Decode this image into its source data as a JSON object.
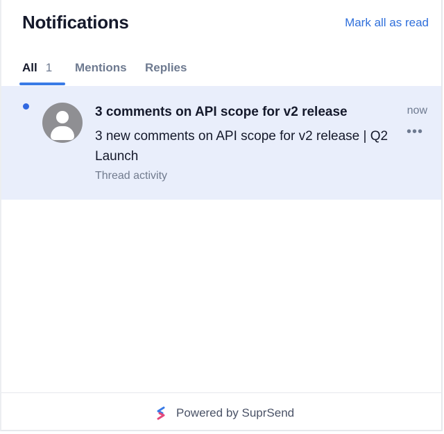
{
  "header": {
    "title": "Notifications",
    "mark_all_label": "Mark all as read"
  },
  "tabs": [
    {
      "label": "All",
      "count": "1",
      "active": true
    },
    {
      "label": "Mentions",
      "active": false
    },
    {
      "label": "Replies",
      "active": false
    }
  ],
  "notifications": [
    {
      "unread": true,
      "title": "3 comments on API scope for v2 release",
      "body": "3 new comments on API scope for v2 release | Q2 Launch",
      "subtext": "Thread activity",
      "time": "now",
      "avatar_icon": "user-avatar-icon",
      "more_icon": "ellipsis-icon"
    }
  ],
  "footer": {
    "powered_by": "Powered by SuprSend",
    "logo_icon": "suprsend-logo-icon"
  },
  "colors": {
    "accent": "#3a7be6",
    "unread_bg": "#e9eefb",
    "unread_dot": "#3168e0",
    "link": "#2f6fdb"
  }
}
